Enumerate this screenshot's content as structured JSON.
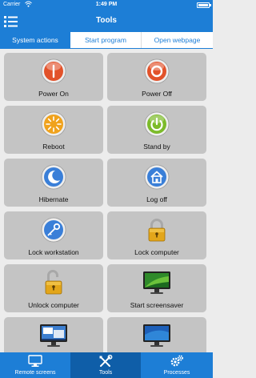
{
  "status_bar": {
    "carrier": "Carrier",
    "time": "1:49 PM"
  },
  "header": {
    "title": "Tools"
  },
  "tabs": [
    {
      "label": "System actions",
      "active": true
    },
    {
      "label": "Start program",
      "active": false
    },
    {
      "label": "Open webpage",
      "active": false
    }
  ],
  "actions": [
    {
      "label": "Power On",
      "icon": "power-on-icon"
    },
    {
      "label": "Power Off",
      "icon": "power-off-icon"
    },
    {
      "label": "Reboot",
      "icon": "reboot-icon"
    },
    {
      "label": "Stand by",
      "icon": "standby-icon"
    },
    {
      "label": "Hibernate",
      "icon": "hibernate-icon"
    },
    {
      "label": "Log off",
      "icon": "log-off-icon"
    },
    {
      "label": "Lock workstation",
      "icon": "lock-workstation-icon"
    },
    {
      "label": "Lock computer",
      "icon": "lock-computer-icon"
    },
    {
      "label": "Unlock computer",
      "icon": "unlock-computer-icon"
    },
    {
      "label": "Start screensaver",
      "icon": "screensaver-icon"
    },
    {
      "label": "",
      "icon": "monitor-icon"
    },
    {
      "label": "",
      "icon": "monitor-icon"
    }
  ],
  "bottom_tabs": [
    {
      "label": "Remote screens",
      "icon": "monitor-icon",
      "active": false
    },
    {
      "label": "Tools",
      "icon": "tools-icon",
      "active": true
    },
    {
      "label": "Processes",
      "icon": "gears-icon",
      "active": false
    }
  ],
  "colors": {
    "primary": "#1d7ed6",
    "tile": "#c4c4c4",
    "power_red": "#e2522a",
    "standby_green": "#7cbb2a",
    "blue": "#3a7fd8",
    "gold": "#e3a61a"
  }
}
